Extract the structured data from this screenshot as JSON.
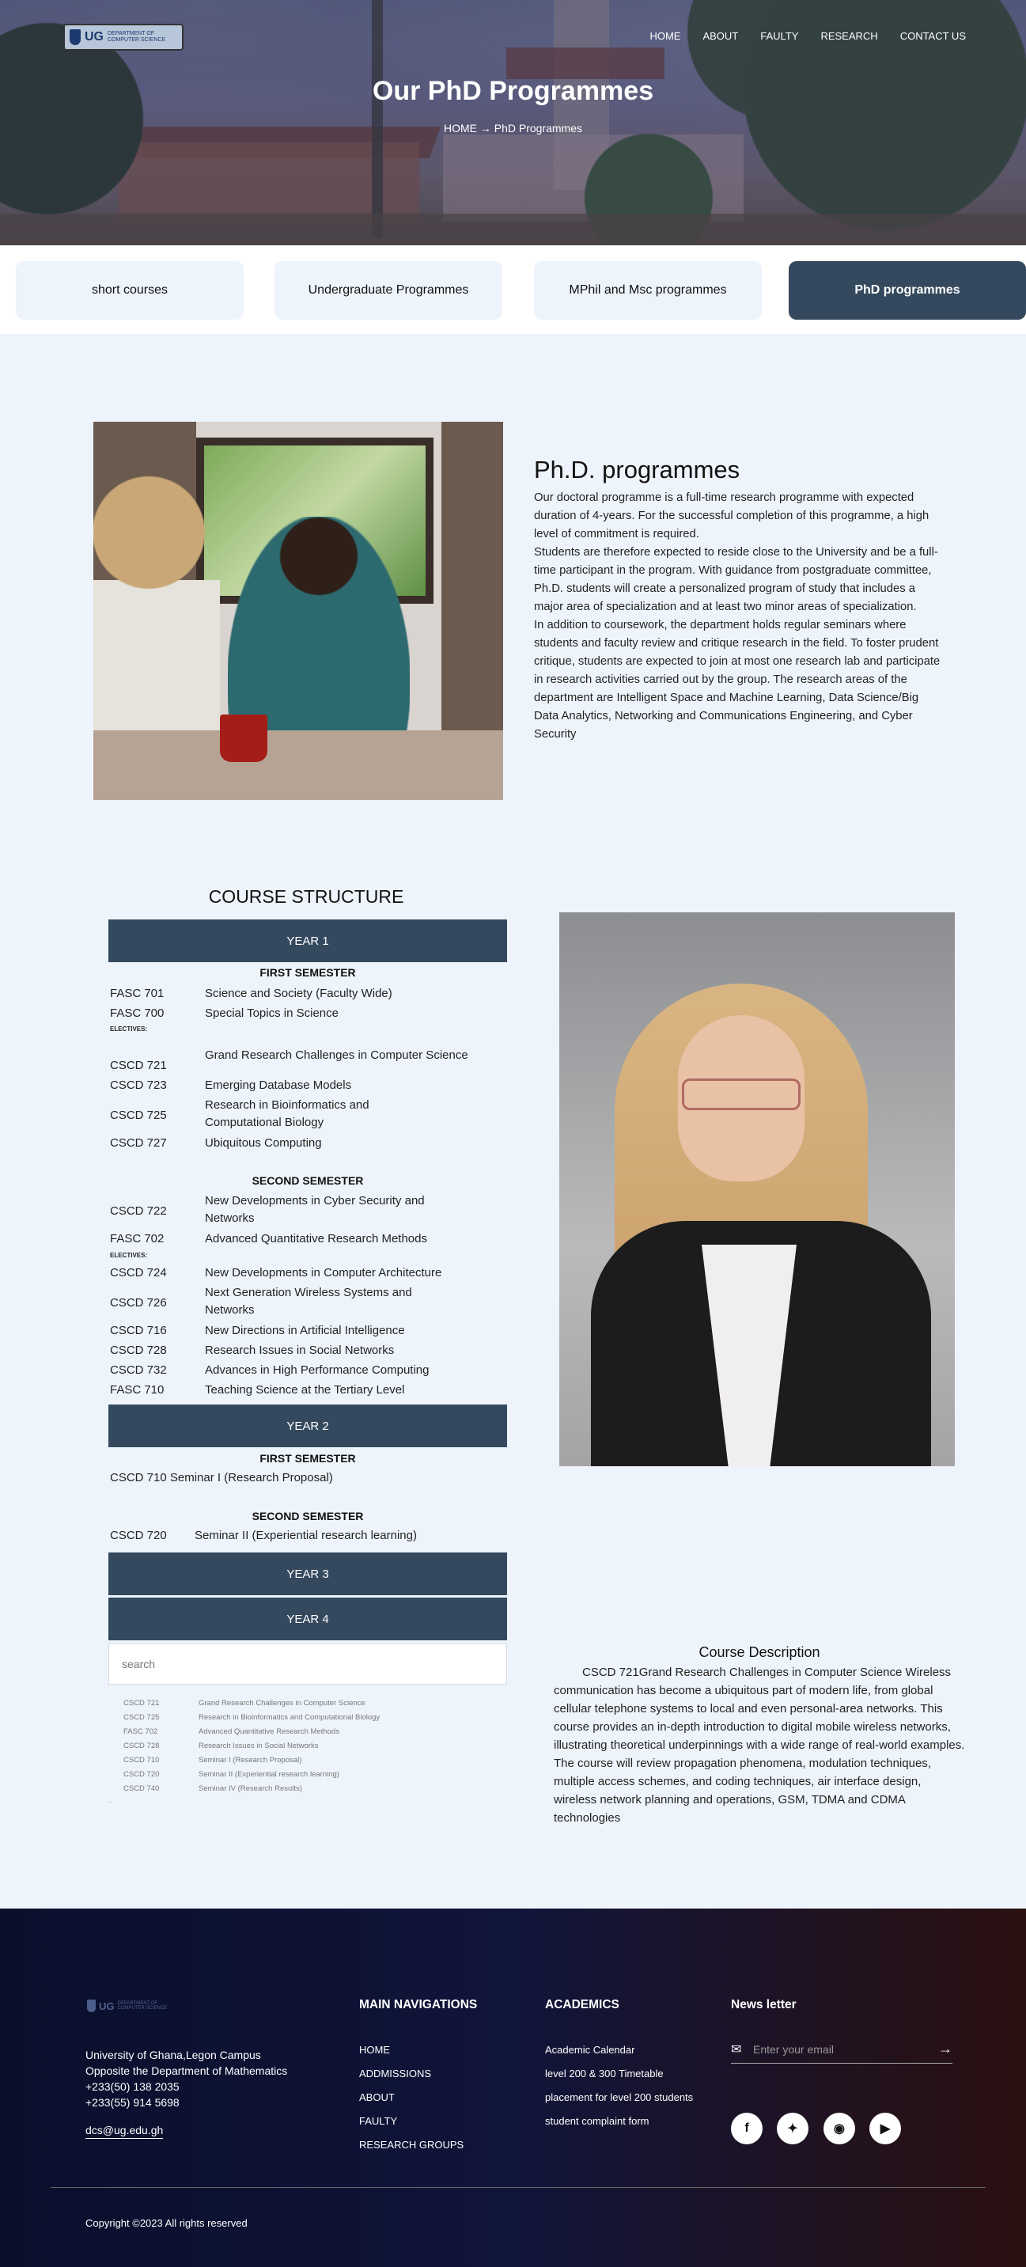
{
  "header": {
    "logo": {
      "ug": "UG",
      "dept_line1": "DEPARTMENT OF",
      "dept_line2": "COMPUTER SCIENCE"
    },
    "nav": [
      "HOME",
      "ABOUT",
      "FAULTY",
      "RESEARCH",
      "CONTACT US"
    ],
    "title": "Our PhD Programmes",
    "breadcrumb": "HOME → PhD Programmes"
  },
  "tabs": [
    {
      "label": "short courses"
    },
    {
      "label": "Undergraduate Programmes"
    },
    {
      "label": "MPhil and Msc programmes"
    },
    {
      "label": "PhD programmes"
    }
  ],
  "phd": {
    "title": "Ph.D. programmes",
    "paragraphs": [
      "Our doctoral programme is a full-time research programme with expected duration of 4-years. For the successful completion of this programme, a high level of commitment is required.",
      "Students are therefore expected to reside close to the University and be a full-time participant in the program. With guidance from postgraduate committee, Ph.D. students will create a personalized program of study that includes a major area of specialization and at least two minor areas of specialization.",
      "In addition to coursework, the department holds regular seminars where students and faculty review and critique research in the field. To foster prudent critique, students are expected to join at most one research lab and participate in research activities carried out by the group. The research areas of the department are Intelligent Space and Machine Learning, Data Science/Big Data Analytics, Networking and Communications Engineering, and Cyber Security"
    ]
  },
  "course_structure": {
    "title": "COURSE STRUCTURE",
    "year1": {
      "label": "YEAR 1",
      "first_semester": {
        "label": "FIRST SEMESTER",
        "core": [
          {
            "code": "FASC 701",
            "name": "Science and Society (Faculty Wide)"
          },
          {
            "code": "FASC 700",
            "name": "Special Topics in Science"
          }
        ],
        "electives_label": "ELECTIVES:",
        "electives": [
          {
            "code": "CSCD 721",
            "name": "Grand Research Challenges in Computer Science"
          },
          {
            "code": "CSCD 723",
            "name": "Emerging Database Models"
          },
          {
            "code": "CSCD 725",
            "name": "Research in Bioinformatics and Computational Biology"
          },
          {
            "code": "CSCD 727",
            "name": "Ubiquitous Computing"
          }
        ]
      },
      "second_semester": {
        "label": "SECOND SEMESTER",
        "core": [
          {
            "code": "CSCD 722",
            "name": "New Developments in Cyber Security and Networks"
          },
          {
            "code": "FASC 702",
            "name": "Advanced Quantitative Research Methods"
          }
        ],
        "electives_label": "ELECTIVES:",
        "electives": [
          {
            "code": "CSCD 724",
            "name": "New Developments in Computer Architecture"
          },
          {
            "code": "CSCD 726",
            "name": "Next Generation Wireless Systems and Networks"
          },
          {
            "code": "CSCD 716",
            "name": "New Directions in Artificial Intelligence"
          },
          {
            "code": "CSCD 728",
            "name": "Research Issues in Social Networks"
          },
          {
            "code": "CSCD 732",
            "name": "Advances in High Performance Computing"
          },
          {
            "code": "FASC 710",
            "name": "Teaching Science at the Tertiary Level"
          }
        ]
      }
    },
    "year2": {
      "label": "YEAR 2",
      "first_semester_label": "FIRST SEMESTER",
      "first_row": "CSCD 710  Seminar I (Research Proposal)",
      "second_semester_label": "SECOND SEMESTER",
      "second_code": "CSCD 720",
      "second_name": "Seminar II (Experiential research learning)"
    },
    "year3": {
      "label": "YEAR 3"
    },
    "year4": {
      "label": "YEAR 4"
    }
  },
  "search": {
    "placeholder": "search",
    "results": [
      {
        "code": "CSCD 721",
        "name": "Grand Research Challenges in Computer Science"
      },
      {
        "code": "CSCD 725",
        "name": "Research in Bioinformatics and Computational Biology"
      },
      {
        "code": "FASC 702",
        "name": "Advanced Quantitative Research Methods"
      },
      {
        "code": "CSCD 728",
        "name": "Research Issues in Social Networks"
      },
      {
        "code": "CSCD 710",
        "name": "Seminar I (Research Proposal)"
      },
      {
        "code": "CSCD 720",
        "name": "Seminar II (Experiential research learning)"
      },
      {
        "code": "CSCD 740",
        "name": "Seminar IV (Research Results)"
      }
    ],
    "trailing": "."
  },
  "course_description": {
    "title": "Course Description",
    "text": "CSCD 721Grand Research Challenges in Computer Science Wireless communication has become a ubiquitous part of modern life, from global cellular telephone systems to local and even personal-area networks. This course provides an in-depth introduction to digital mobile wireless networks, illustrating theoretical underpinnings with a wide range of real-world examples. The course will review propagation phenomena, modulation techniques, multiple access schemes, and coding techniques, air interface design, wireless network planning and operations, GSM, TDMA and CDMA technologies"
  },
  "footer": {
    "logo": {
      "ug": "UG",
      "dept_line1": "DEPARTMENT OF",
      "dept_line2": "COMPUTER SCIENCE"
    },
    "address": [
      "University of Ghana,Legon Campus",
      "Opposite the Department of Mathematics",
      "+233(50) 138 2035",
      "+233(55) 914 5698"
    ],
    "email": "dcs@ug.edu.gh",
    "main_nav_title": "MAIN NAVIGATIONS",
    "main_nav": [
      "HOME",
      "ADDMISSIONS",
      "ABOUT",
      "FAULTY",
      "RESEARCH GROUPS"
    ],
    "academics_title": "ACADEMICS",
    "academics": [
      "Academic Calendar",
      "level 200 & 300 Timetable",
      "placement for level 200 students",
      "student complaint form"
    ],
    "newsletter_title": "News letter",
    "newsletter_placeholder": "Enter your email",
    "social": [
      "facebook-icon",
      "twitter-icon",
      "instagram-icon",
      "youtube-icon"
    ],
    "copyright": "Copyright ©2023 All rights reserved"
  },
  "colors": {
    "accent": "#34495e",
    "page_bg": "#eef4fb",
    "footer_start": "#0a0f2c",
    "footer_end": "#2a1010"
  }
}
